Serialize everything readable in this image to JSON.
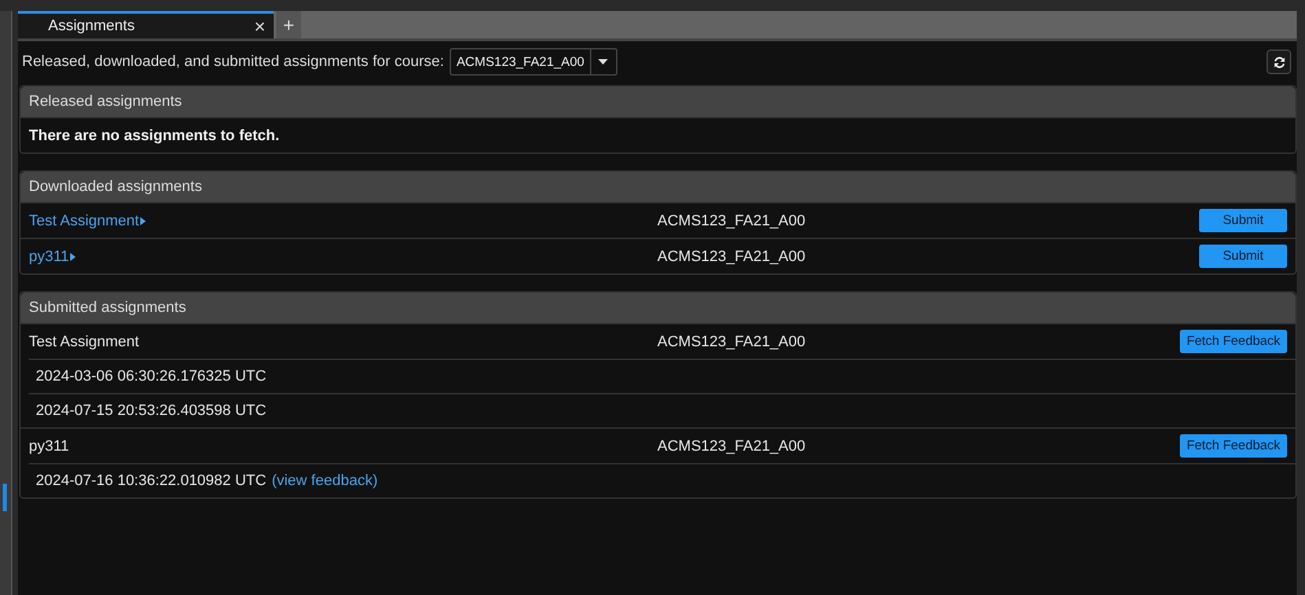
{
  "tabs": [
    {
      "label": "Assignments",
      "selected": true,
      "close": "×"
    }
  ],
  "new_tab": "+",
  "toolbar": {
    "label": "Released, downloaded, and submitted assignments for course:",
    "course": "ACMS123_FA21_A00"
  },
  "released": {
    "title": "Released assignments",
    "message": "There are no assignments to fetch."
  },
  "downloaded": {
    "title": "Downloaded assignments",
    "rows": [
      {
        "name": "Test Assignment",
        "course": "ACMS123_FA21_A00",
        "action": "Submit"
      },
      {
        "name": "py311",
        "course": "ACMS123_FA21_A00",
        "action": "Submit"
      }
    ]
  },
  "submitted": {
    "title": "Submitted assignments",
    "rows": [
      {
        "name": "Test Assignment",
        "course": "ACMS123_FA21_A00",
        "action": "Fetch Feedback",
        "submissions": [
          {
            "timestamp": "2024-03-06 06:30:26.176325 UTC"
          },
          {
            "timestamp": "2024-07-15 20:53:26.403598 UTC"
          }
        ]
      },
      {
        "name": "py311",
        "course": "ACMS123_FA21_A00",
        "action": "Fetch Feedback",
        "submissions": [
          {
            "timestamp": "2024-07-16 10:36:22.010982 UTC",
            "feedback_link": "(view feedback)"
          }
        ]
      }
    ]
  }
}
